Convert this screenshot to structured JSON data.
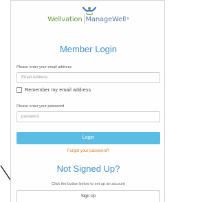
{
  "logo": {
    "brand": "Wellvation",
    "product": "ManageWell",
    "tm": "®"
  },
  "login": {
    "title": "Member Login",
    "email_label": "Please enter your email address",
    "email_placeholder": "Email Address",
    "remember_label": "Remember my email address",
    "password_label": "Please enter your password",
    "password_placeholder": "password",
    "login_button": "Login",
    "forgot_link": "Forgot your password?"
  },
  "signup": {
    "title": "Not Signed Up?",
    "helper": "Click the button below to set up an account",
    "button": "Sign Up"
  },
  "colors": {
    "accent_blue": "#3c8ccf",
    "button_blue": "#5bbde3",
    "link_orange": "#e07b1f",
    "brand_green": "#6d9a46"
  },
  "icons": {
    "logo_mark": "wellvation-person-logo",
    "annotation": "pointer-arrow"
  }
}
